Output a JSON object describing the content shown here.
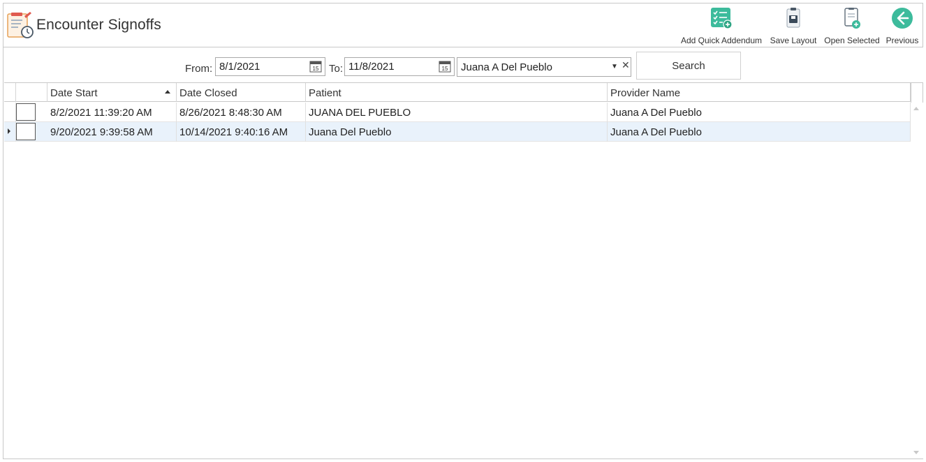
{
  "header": {
    "title": "Encounter Signoffs",
    "app_icon": "checklist-clock-icon"
  },
  "toolbar": {
    "add_quick_addendum": {
      "label": "Add Quick Addendum",
      "icon": "checklist-plus-icon"
    },
    "save_layout": {
      "label": "Save Layout",
      "icon": "clipboard-save-icon"
    },
    "open_selected": {
      "label": "Open Selected",
      "icon": "document-plus-icon"
    },
    "previous": {
      "label": "Previous",
      "icon": "arrow-left-circle-icon"
    }
  },
  "filters": {
    "from_label": "From:",
    "from_value": "8/1/2021",
    "to_label": "To:",
    "to_value": "11/8/2021",
    "provider_value": "Juana A Del Pueblo",
    "search_label": "Search",
    "calendar_day": "15"
  },
  "grid": {
    "columns": [
      "Date Start",
      "Date Closed",
      "Patient",
      "Provider Name"
    ],
    "sorted_column": "Date Start",
    "sort_direction": "ascending",
    "rows": [
      {
        "date_start": "8/2/2021 11:39:20 AM",
        "date_closed": "8/26/2021 8:48:30 AM",
        "patient": "JUANA DEL PUEBLO",
        "provider": "Juana A Del Pueblo",
        "selected": false
      },
      {
        "date_start": "9/20/2021 9:39:58 AM",
        "date_closed": "10/14/2021 9:40:16 AM",
        "patient": "Juana Del Pueblo",
        "provider": "Juana A Del Pueblo",
        "selected": true
      }
    ]
  },
  "colors": {
    "accent_teal": "#3dbb9c",
    "selected_row": "#e9f2fb",
    "border": "#c8c8c8"
  }
}
